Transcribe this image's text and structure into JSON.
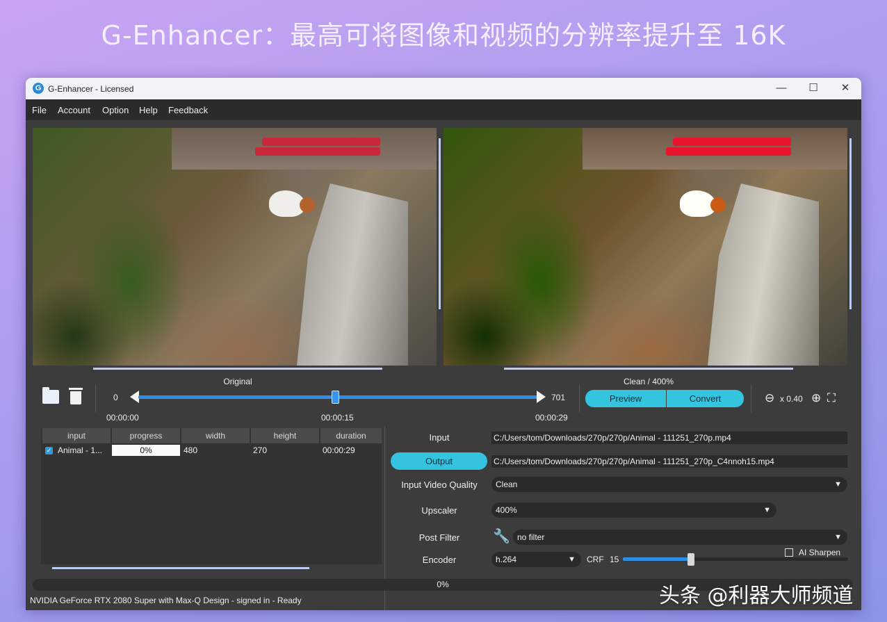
{
  "banner": {
    "title": "G-Enhancer：最高可将图像和视频的分辨率提升至 16K"
  },
  "window": {
    "title": "G-Enhancer - Licensed",
    "controls": {
      "minimize": "—",
      "maximize": "☐",
      "close": "✕"
    }
  },
  "menu": [
    "File",
    "Account",
    "Option",
    "Help",
    "Feedback"
  ],
  "preview": {
    "left_caption": "Original",
    "right_caption": "Clean / 400%"
  },
  "timeline": {
    "start_frame": "0",
    "end_frame": "701",
    "current_frame_fraction": 0.49,
    "time_start": "00:00:00",
    "time_current": "00:00:15",
    "time_end": "00:00:29"
  },
  "actions": {
    "preview": "Preview",
    "convert": "Convert"
  },
  "zoom": {
    "label": "x 0.40"
  },
  "table": {
    "headers": [
      "input",
      "progress",
      "width",
      "height",
      "duration"
    ],
    "rows": [
      {
        "checked": true,
        "input": "Animal - 1...",
        "progress": "0%",
        "width": "480",
        "height": "270",
        "duration": "00:00:29"
      }
    ]
  },
  "settings": {
    "input_label": "Input",
    "input_path": "C:/Users/tom/Downloads/270p/270p/Animal - 111251_270p.mp4",
    "output_label": "Output",
    "output_path": "C:/Users/tom/Downloads/270p/270p/Animal - 111251_270p_C4nnoh15.mp4",
    "quality_label": "Input Video Quality",
    "quality_value": "Clean",
    "upscaler_label": "Upscaler",
    "upscaler_value": "400%",
    "ai_sharpen_label": "AI Sharpen",
    "ai_sharpen_checked": false,
    "post_filter_label": "Post Filter",
    "post_filter_value": "no filter",
    "encoder_label": "Encoder",
    "encoder_value": "h.264",
    "crf_label": "CRF",
    "crf_value": "15"
  },
  "overall_progress": "0%",
  "status": "NVIDIA GeForce RTX 2080 Super with Max-Q Design - signed in - Ready",
  "watermark": "头条 @利器大师频道",
  "colors": {
    "accent": "#35c4e0",
    "slider": "#2f8fe6",
    "background": "#3c3c3c"
  },
  "icons": {
    "open_folder": "folder-icon",
    "delete": "trash-icon",
    "zoom_out": "zoom-out-icon",
    "zoom_in": "zoom-in-icon",
    "fullscreen": "fullscreen-icon",
    "filter_settings": "wrench-icon"
  }
}
